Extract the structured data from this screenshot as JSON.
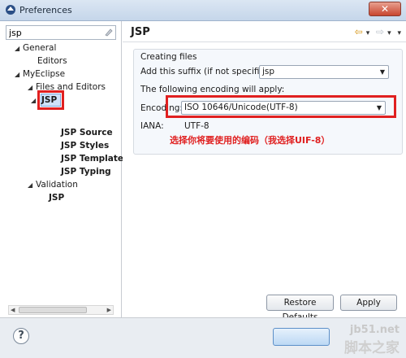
{
  "window": {
    "title": "Preferences",
    "close_glyph": "✕"
  },
  "filter": {
    "value": "jsp"
  },
  "tree": {
    "general": "General",
    "editors": "Editors",
    "myeclipse": "MyEclipse",
    "files_and_editors": "Files and Editors",
    "jsp": "JSP",
    "jsp_source": "JSP Source",
    "jsp_styles": "JSP Styles",
    "jsp_templates": "JSP Template:",
    "jsp_typing": "JSP Typing",
    "validation": "Validation",
    "validation_jsp": "JSP"
  },
  "page": {
    "title": "JSP",
    "group_label": "Creating files",
    "suffix_label": "Add this suffix (if not specified):",
    "suffix_value": "jsp",
    "encoding_intro": "The following encoding will apply:",
    "encoding_label": "Encoding:",
    "encoding_value": "ISO 10646/Unicode(UTF-8)",
    "iana_label": "IANA:",
    "iana_value": "UTF-8",
    "annotation": "选择你将要使用的编码（我选择UIF-8）"
  },
  "buttons": {
    "restore_defaults": "Restore Defaults",
    "apply": "Apply",
    "help": "?"
  },
  "watermark": {
    "url": "jb51.net",
    "text": "脚本之家"
  },
  "colors": {
    "highlight_red": "#e02020",
    "selection_blue": "#cfe3fb"
  }
}
